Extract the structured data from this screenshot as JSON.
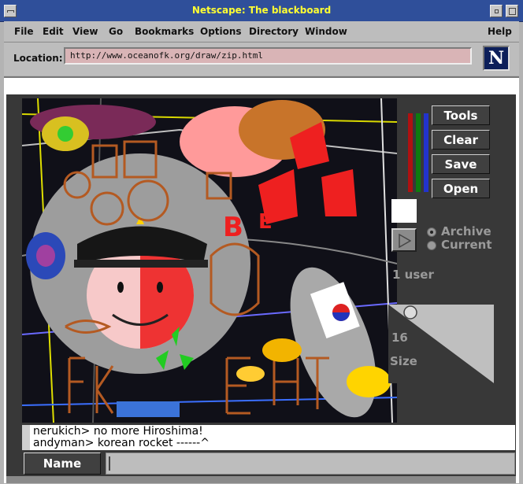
{
  "window": {
    "title": "Netscape: The blackboard"
  },
  "menu": [
    "File",
    "Edit",
    "View",
    "Go",
    "Bookmarks",
    "Options",
    "Directory",
    "Window",
    "Help"
  ],
  "location": {
    "label": "Location:",
    "url": "http://www.oceanofk.org/draw/zip.html",
    "logo": "N"
  },
  "panel": {
    "buttons": [
      "Tools",
      "Clear",
      "Save",
      "Open"
    ],
    "color_sliders": [
      {
        "color": "#b01010"
      },
      {
        "color": "#0f7a0f"
      },
      {
        "color": "#2233cc"
      }
    ],
    "radio": [
      {
        "label": "Archive",
        "selected": true
      },
      {
        "label": "Current",
        "selected": false
      }
    ],
    "users": "1 user",
    "size_value": "16",
    "size_label": "Size"
  },
  "chat": {
    "lines": [
      "nerukich> no more Hiroshima!",
      "andyman> korean rocket ------^"
    ]
  },
  "name_button": "Name",
  "icons": {
    "play": "play-icon",
    "logo": "netscape-logo-icon"
  }
}
